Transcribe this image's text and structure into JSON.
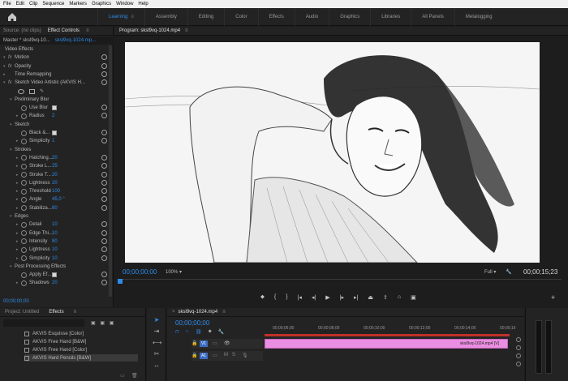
{
  "menu": [
    "File",
    "Edit",
    "Clip",
    "Sequence",
    "Markers",
    "Graphics",
    "Window",
    "Help"
  ],
  "workspaces": [
    {
      "label": "Learning",
      "active": true
    },
    {
      "label": "Assembly"
    },
    {
      "label": "Editing"
    },
    {
      "label": "Color"
    },
    {
      "label": "Effects"
    },
    {
      "label": "Audio"
    },
    {
      "label": "Graphics"
    },
    {
      "label": "Libraries"
    },
    {
      "label": "All Panels"
    },
    {
      "label": "Metalogging"
    }
  ],
  "left_panel": {
    "tab_source": "Source: (no clips)",
    "tab_effect_controls": "Effect Controls",
    "master": "Master * sksl9vq-10...",
    "clip": "sksl9vq-1024.mp...",
    "rows": [
      {
        "label": "Video Effects",
        "type": "header"
      },
      {
        "label": "Motion",
        "type": "fx"
      },
      {
        "label": "Opacity",
        "type": "fx"
      },
      {
        "label": "Time Remapping",
        "type": "plain"
      },
      {
        "label": "Sketch Video Artistic (AKVIS H...",
        "type": "fx"
      },
      {
        "label": "",
        "type": "shapes"
      },
      {
        "label": "Preliminary Blur",
        "type": "group"
      },
      {
        "label": "Use Blur",
        "type": "check"
      },
      {
        "label": "Radius",
        "value": "2",
        "type": "param"
      },
      {
        "label": "Sketch",
        "type": "group"
      },
      {
        "label": "Black &...",
        "type": "check"
      },
      {
        "label": "Simplicity",
        "value": "1",
        "type": "param"
      },
      {
        "label": "Strokes",
        "type": "group"
      },
      {
        "label": "Hatching...",
        "value": "20",
        "type": "param"
      },
      {
        "label": "Stroke L...",
        "value": "25",
        "type": "param"
      },
      {
        "label": "Stroke T...",
        "value": "20",
        "type": "param"
      },
      {
        "label": "Lightness",
        "value": "20",
        "type": "param"
      },
      {
        "label": "Threshold",
        "value": "100",
        "type": "param"
      },
      {
        "label": "Angle",
        "value": "45,0 °",
        "type": "param"
      },
      {
        "label": "Stabiliza...",
        "value": "80",
        "type": "param"
      },
      {
        "label": "Edges",
        "type": "group"
      },
      {
        "label": "Detail",
        "value": "10",
        "type": "param"
      },
      {
        "label": "Edge Thi...",
        "value": "10",
        "type": "param"
      },
      {
        "label": "Intensity",
        "value": "80",
        "type": "param"
      },
      {
        "label": "Lightness",
        "value": "10",
        "type": "param"
      },
      {
        "label": "Simplicity",
        "value": "10",
        "type": "param"
      },
      {
        "label": "Post Processing Effects",
        "type": "group"
      },
      {
        "label": "Apply Ef...",
        "type": "check"
      },
      {
        "label": "Shadows",
        "value": "20",
        "type": "param"
      }
    ],
    "timecode": "00;00;00;00"
  },
  "program": {
    "tab": "Program: sksl9vq-1024.mp4",
    "timecode_left": "00;00;00;00",
    "zoom": "100%",
    "quality": "Full",
    "timecode_right": "00;00;15;23"
  },
  "project": {
    "tab_project": "Project: Untitled",
    "tab_effects": "Effects",
    "items": [
      {
        "label": "AKVIS Esquisse [Color]"
      },
      {
        "label": "AKVIS Free Hand [B&W]"
      },
      {
        "label": "AKVIS Free Hand [Color]"
      },
      {
        "label": "AKVIS Hard Pencils [B&W]",
        "selected": true
      }
    ]
  },
  "timeline": {
    "tab": "sksl9vq-1024.mp4",
    "timecode": "00;00;00;00",
    "ticks": [
      "00;00;06;00",
      "00;00;08;00",
      "00;00;10;00",
      "00;00;12;00",
      "00;00;14;00",
      "00;00;16"
    ],
    "v1": "V1",
    "a1": "A1",
    "clip_label": "sksl9vq-1024.mp4 [V]"
  }
}
